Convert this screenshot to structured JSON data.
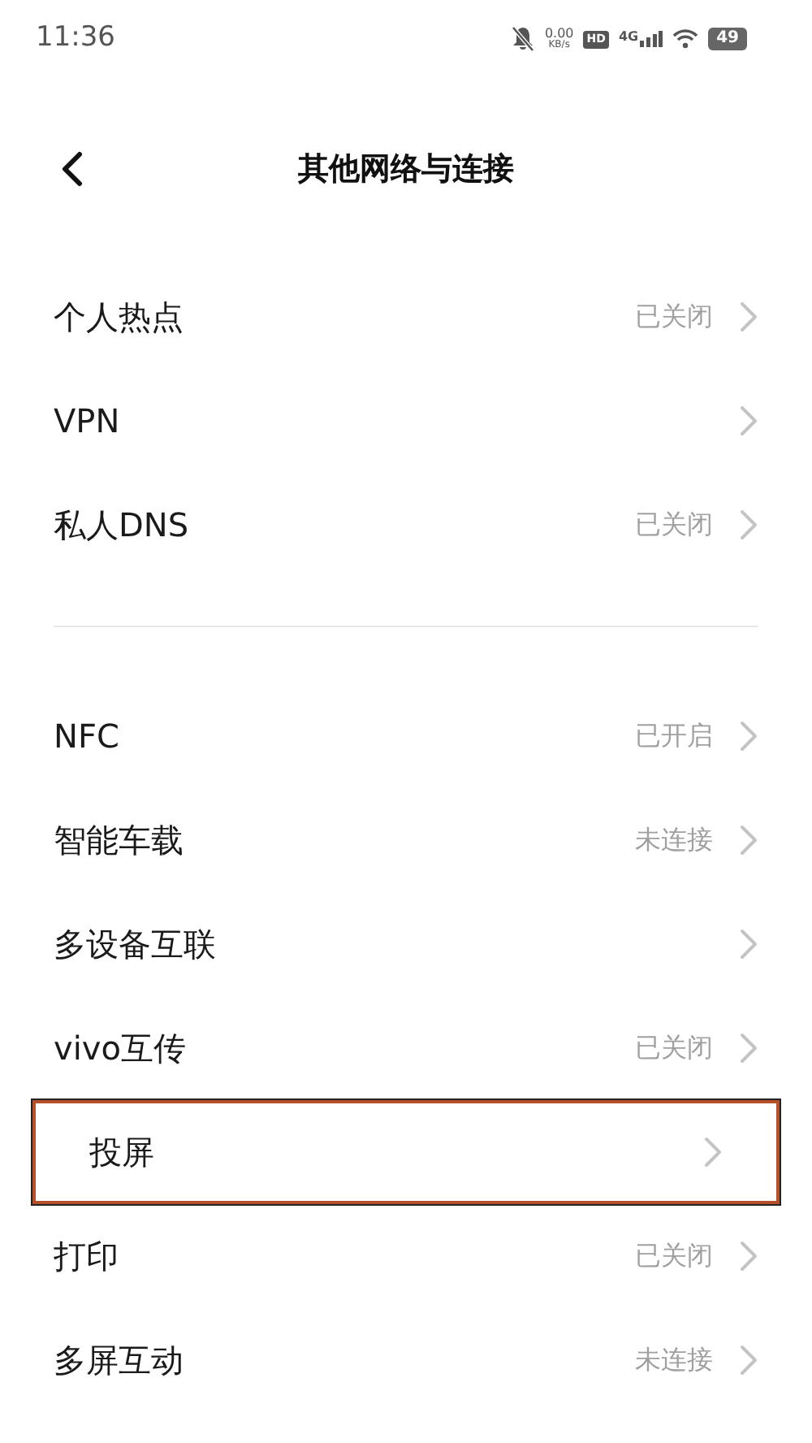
{
  "status_bar": {
    "time": "11:36",
    "speed_value": "0.00",
    "speed_unit": "KB/s",
    "hd_badge": "HD",
    "network": "4G",
    "battery": "49"
  },
  "header": {
    "title": "其他网络与连接"
  },
  "groups": [
    {
      "items": [
        {
          "label": "个人热点",
          "value": "已关闭",
          "highlighted": false
        },
        {
          "label": "VPN",
          "highlighted": false
        },
        {
          "label": "私人DNS",
          "value": "已关闭",
          "highlighted": false
        }
      ]
    },
    {
      "items": [
        {
          "label": "NFC",
          "value": "已开启",
          "highlighted": false
        },
        {
          "label": "智能车载",
          "value": "未连接",
          "highlighted": false
        },
        {
          "label": "多设备互联",
          "highlighted": false
        },
        {
          "label": "vivo互传",
          "value": "已关闭",
          "highlighted": false
        },
        {
          "label": "投屏",
          "highlighted": true
        },
        {
          "label": "打印",
          "value": "已关闭",
          "highlighted": false
        },
        {
          "label": "多屏互动",
          "value": "未连接",
          "highlighted": false
        }
      ]
    }
  ]
}
